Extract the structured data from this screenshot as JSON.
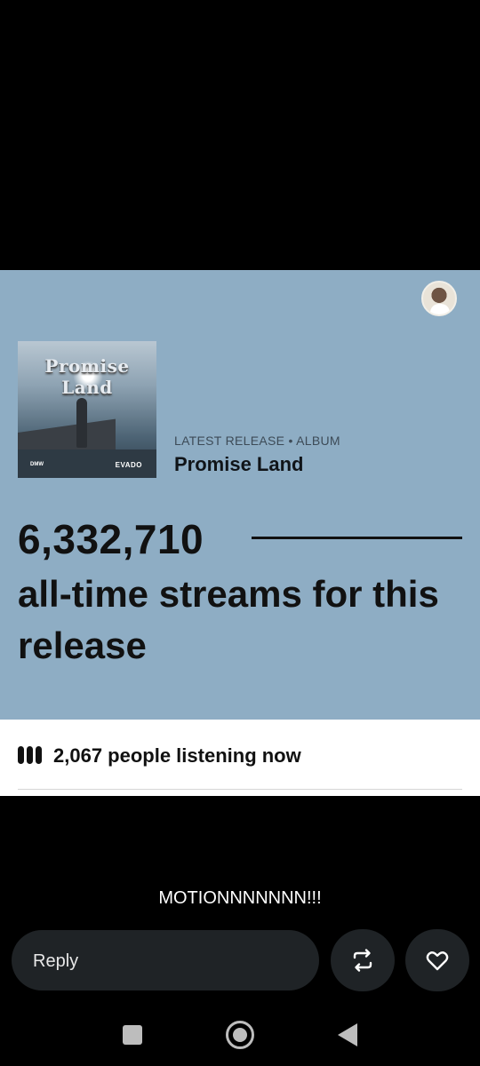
{
  "card": {
    "cover": {
      "title": "Promise Land",
      "label_left": "DMW",
      "label_right": "EVADO"
    },
    "release_meta": "LATEST RELEASE • ALBUM",
    "release_title": "Promise Land",
    "streams_count": "6,332,710",
    "streams_text": "all-time streams for this release"
  },
  "listening": {
    "count_text": "2,067 people listening now",
    "icon": "equalizer-bars-icon"
  },
  "post": {
    "caption": "MOTIONNNNNNN!!!"
  },
  "actions": {
    "reply_placeholder": "Reply",
    "repost_icon": "repost-icon",
    "like_icon": "heart-icon"
  },
  "colors": {
    "card_bg": "#8eadc4",
    "page_bg": "#000000",
    "button_bg": "#1f2326"
  }
}
